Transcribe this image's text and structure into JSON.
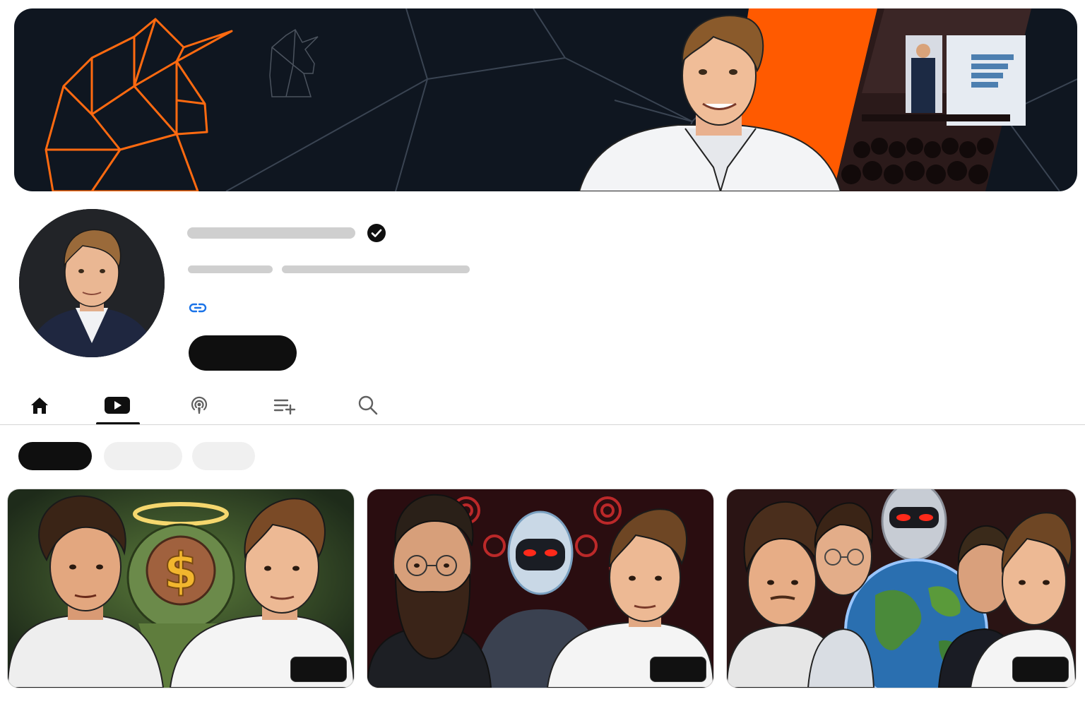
{
  "colors": {
    "accent_orange": "#ff5a00",
    "banner_bg": "#0f1620",
    "text_primary": "#0f0f0f",
    "placeholder_gray": "#cfcfcf",
    "chip_inactive": "#f0f0f0"
  },
  "channel": {
    "verified_icon": "verified-check-icon",
    "link_icon": "link-icon"
  },
  "tabs": [
    {
      "icon": "home-icon",
      "active": false
    },
    {
      "icon": "videos-play-icon",
      "active": true
    },
    {
      "icon": "podcasts-icon",
      "active": false
    },
    {
      "icon": "playlist-add-icon",
      "active": false
    },
    {
      "icon": "search-icon",
      "active": false
    }
  ],
  "videos": [
    {
      "thumbnail": "two-men-money-brain-halo"
    },
    {
      "thumbnail": "bearded-man-robot-red-eyes"
    },
    {
      "thumbnail": "group-earth-robot"
    }
  ]
}
